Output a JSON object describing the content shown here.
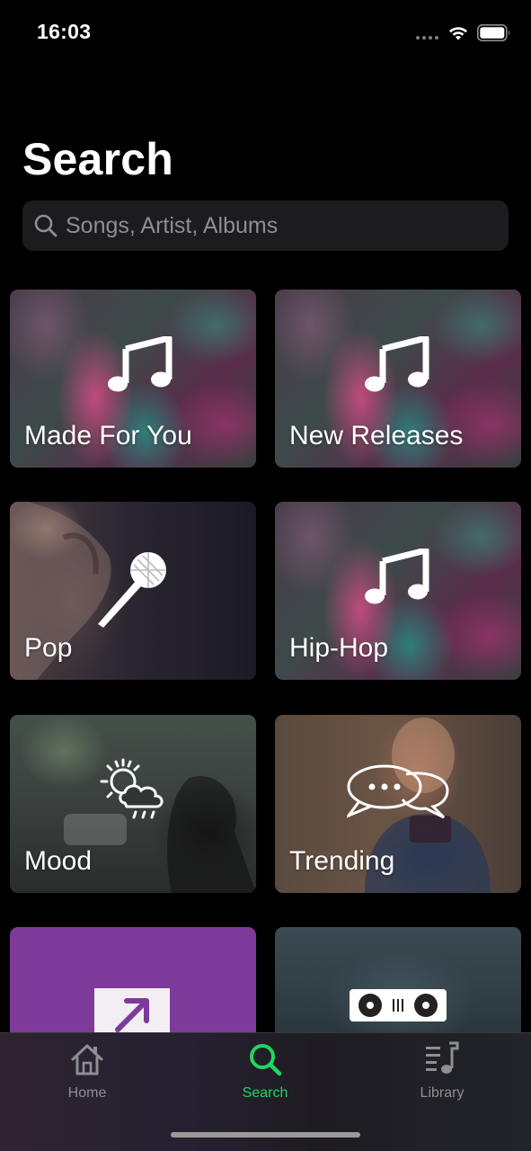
{
  "status_bar": {
    "time": "16:03",
    "icons": [
      "cellular-dots-icon",
      "wifi-icon",
      "battery-icon"
    ]
  },
  "page": {
    "title": "Search"
  },
  "search": {
    "placeholder": "Songs, Artist, Albums",
    "value": "",
    "icon": "search-icon"
  },
  "categories": [
    {
      "label": "Made For You",
      "icon": "music-note-icon",
      "background": "abstract-art"
    },
    {
      "label": "New Releases",
      "icon": "music-note-icon",
      "background": "abstract-art"
    },
    {
      "label": "Pop",
      "icon": "microphone-icon",
      "background": "singer-photo"
    },
    {
      "label": "Hip-Hop",
      "icon": "music-note-icon",
      "background": "abstract-art"
    },
    {
      "label": "Mood",
      "icon": "weather-icon",
      "background": "street-photo"
    },
    {
      "label": "Trending",
      "icon": "chat-bubbles-icon",
      "background": "woman-phone-photo"
    },
    {
      "label": "",
      "icon": "trending-arrow-icon",
      "background": "purple"
    },
    {
      "label": "",
      "icon": "turntables-icon",
      "background": "dj-photo"
    }
  ],
  "tab_bar": {
    "tabs": [
      {
        "label": "Home",
        "icon": "home-icon",
        "active": false
      },
      {
        "label": "Search",
        "icon": "search-icon",
        "active": true
      },
      {
        "label": "Library",
        "icon": "library-icon",
        "active": false
      }
    ]
  },
  "colors": {
    "background": "#000000",
    "accent_active_tab": "#1ed760",
    "inactive_tab": "#8e8e93",
    "search_field": "#1c1c1e",
    "tile_purple": "#7d3a9b"
  }
}
